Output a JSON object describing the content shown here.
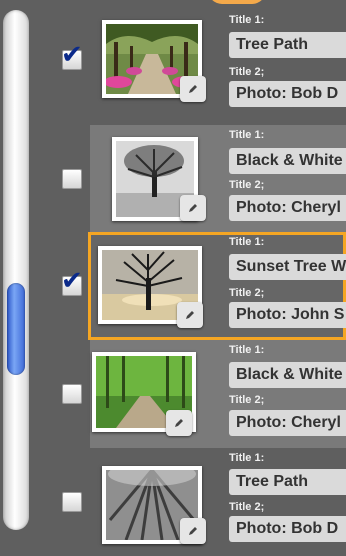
{
  "rows": [
    {
      "title1_label": "Title 1:",
      "title1": "Tree Path",
      "title2_label": "Title 2;",
      "title2": "Photo: Bob D",
      "checked": true,
      "checkmark": "✔",
      "selected": false,
      "alt": false,
      "image": "tree-avenue-with-pink-flowers"
    },
    {
      "title1_label": "Title 1:",
      "title1": "Black & White",
      "title2_label": "Title 2;",
      "title2": "Photo: Cheryl",
      "checked": false,
      "checkmark": "",
      "selected": false,
      "alt": true,
      "image": "black-and-white-lone-tree"
    },
    {
      "title1_label": "Title 1:",
      "title1": "Sunset Tree W",
      "title2_label": "Title 2;",
      "title2": "Photo: John S",
      "checked": true,
      "checkmark": "✔",
      "selected": true,
      "alt": false,
      "image": "sunset-bare-tree"
    },
    {
      "title1_label": "Title 1:",
      "title1": "Black & White",
      "title2_label": "Title 2;",
      "title2": "Photo: Cheryl",
      "checked": false,
      "checkmark": "",
      "selected": false,
      "alt": true,
      "image": "green-forest-path"
    },
    {
      "title1_label": "Title 1:",
      "title1": "Tree Path",
      "title2_label": "Title 2;",
      "title2": "Photo: Bob D",
      "checked": false,
      "checkmark": "",
      "selected": false,
      "alt": false,
      "image": "grey-forest-canopy"
    }
  ],
  "colors": {
    "selection": "#f5a623",
    "scroll_thumb": "#3d68d6",
    "checkmark": "#0b2a8a"
  },
  "icons": {
    "edit": "pencil-icon"
  }
}
